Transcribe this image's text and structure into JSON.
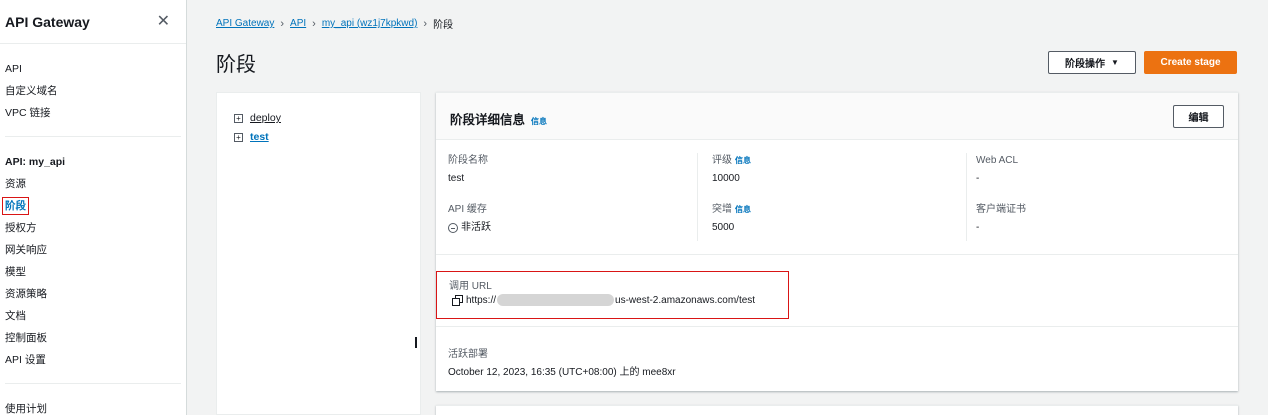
{
  "sidebar": {
    "title": "API Gateway",
    "top_items": [
      "API",
      "自定义域名",
      "VPC 链接"
    ],
    "section_title": "API: my_api",
    "api_items": [
      "资源",
      "阶段",
      "授权方",
      "网关响应",
      "模型",
      "资源策略",
      "文档",
      "控制面板",
      "API 设置"
    ],
    "bottom_item": "使用计划"
  },
  "breadcrumb": {
    "items": [
      "API Gateway",
      "API",
      "my_api (wz1j7kpkwd)"
    ],
    "current": "阶段"
  },
  "page": {
    "title": "阶段",
    "actions_label": "阶段操作",
    "create_label": "Create stage"
  },
  "tree": {
    "items": [
      "deploy",
      "test"
    ]
  },
  "details": {
    "title": "阶段详细信息",
    "info": "信息",
    "edit_label": "编辑",
    "stage_name_label": "阶段名称",
    "stage_name_value": "test",
    "rate_label": "评级",
    "rate_value": "10000",
    "web_acl_label": "Web ACL",
    "web_acl_value": "-",
    "cache_label": "API 缓存",
    "cache_value": "非活跃",
    "burst_label": "突增",
    "burst_value": "5000",
    "client_cert_label": "客户端证书",
    "client_cert_value": "-",
    "invoke_url_label": "调用 URL",
    "invoke_url_prefix": "https://",
    "invoke_url_suffix": "us-west-2.amazonaws.com/test",
    "active_deploy_label": "活跃部署",
    "active_deploy_value": "October 12, 2023, 16:35 (UTC+08:00) 上的 mee8xr"
  },
  "colors": {
    "accent": "#0073bb",
    "primary_button": "#ec7211",
    "highlight": "#d91515"
  }
}
